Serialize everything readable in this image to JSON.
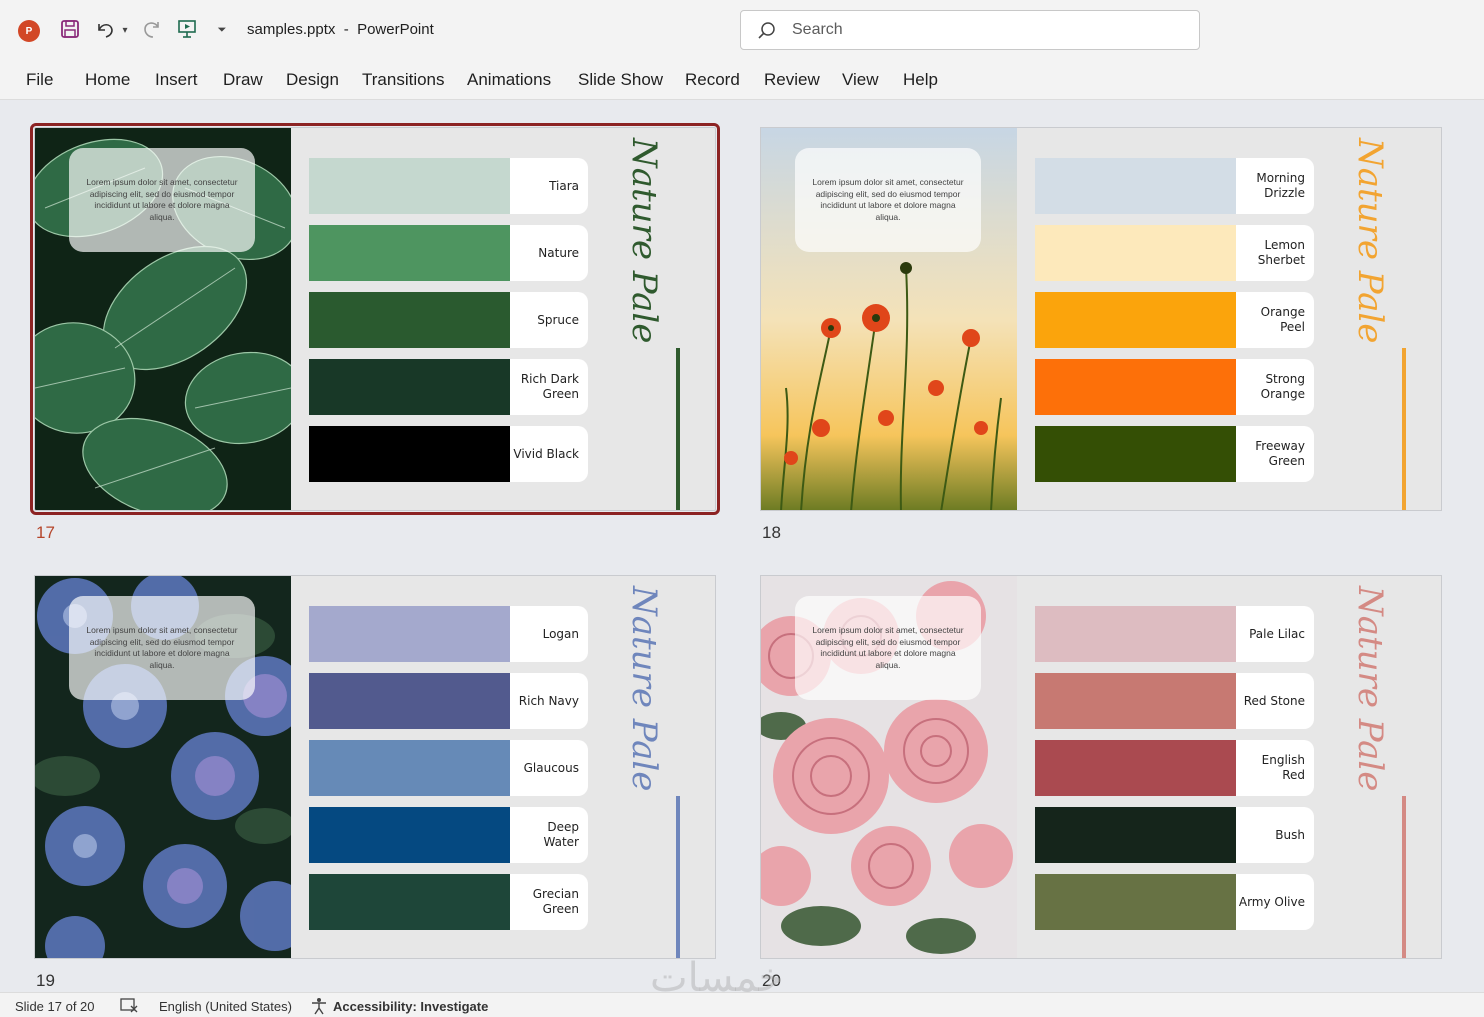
{
  "app": {
    "logo_letter": "P",
    "file_name": "samples.pptx",
    "separator": "-",
    "app_name": "PowerPoint",
    "search_placeholder": "Search"
  },
  "menu": [
    "File",
    "Home",
    "Insert",
    "Draw",
    "Design",
    "Transitions",
    "Animations",
    "Slide Show",
    "Record",
    "Review",
    "View",
    "Help"
  ],
  "slides": [
    {
      "number": "17",
      "selected": true,
      "title_art": "Nature Palette",
      "accent": "#2f5a2e",
      "lorem": "Lorem ipsum dolor sit amet, consectetur adipiscing elit, sed do eiusmod tempor incididunt ut labore et dolore magna aliqua.",
      "swatches": [
        {
          "label": "Tiara",
          "color": "#c5d8cf"
        },
        {
          "label": "Nature",
          "color": "#4e9560"
        },
        {
          "label": "Spruce",
          "color": "#2a5a2f"
        },
        {
          "label": "Rich Dark Green",
          "color": "#183827"
        },
        {
          "label": "Vivid Black",
          "color": "#000000"
        }
      ]
    },
    {
      "number": "18",
      "selected": false,
      "title_art": "Nature Palette",
      "accent": "#f2a431",
      "lorem": "Lorem ipsum dolor sit amet, consectetur adipiscing elit, sed do eiusmod tempor incididunt ut labore et dolore magna aliqua.",
      "swatches": [
        {
          "label": "Morning Drizzle",
          "color": "#d3dde6"
        },
        {
          "label": "Lemon Sherbet",
          "color": "#fde9bb"
        },
        {
          "label": "Orange Peel",
          "color": "#fba40c"
        },
        {
          "label": "Strong Orange",
          "color": "#fd7009"
        },
        {
          "label": "Freeway Green",
          "color": "#344f05"
        }
      ]
    },
    {
      "number": "19",
      "selected": false,
      "title_art": "Nature Palette",
      "accent": "#6f86bc",
      "lorem": "Lorem ipsum dolor sit amet, consectetur adipiscing elit, sed do eiusmod tempor incididunt ut labore et dolore magna aliqua.",
      "swatches": [
        {
          "label": "Logan",
          "color": "#a4a9cd"
        },
        {
          "label": "Rich Navy",
          "color": "#525a8e"
        },
        {
          "label": "Glaucous",
          "color": "#668ab7"
        },
        {
          "label": "Deep Water",
          "color": "#054981"
        },
        {
          "label": "Grecian Green",
          "color": "#1e4639"
        }
      ]
    },
    {
      "number": "20",
      "selected": false,
      "title_art": "Nature Palette",
      "accent": "#d48a84",
      "lorem": "Lorem ipsum dolor sit amet, consectetur adipiscing elit, sed do eiusmod tempor incididunt ut labore et dolore magna aliqua.",
      "swatches": [
        {
          "label": "Pale Lilac",
          "color": "#ddbcc1"
        },
        {
          "label": "Red Stone",
          "color": "#c77972"
        },
        {
          "label": "English Red",
          "color": "#aa4a50"
        },
        {
          "label": "Bush",
          "color": "#15251b"
        },
        {
          "label": "Army Olive",
          "color": "#677244"
        }
      ]
    }
  ],
  "status": {
    "slide_info": "Slide 17 of 20",
    "language": "English (United States)",
    "accessibility": "Accessibility: Investigate"
  },
  "watermark": "خمسات"
}
